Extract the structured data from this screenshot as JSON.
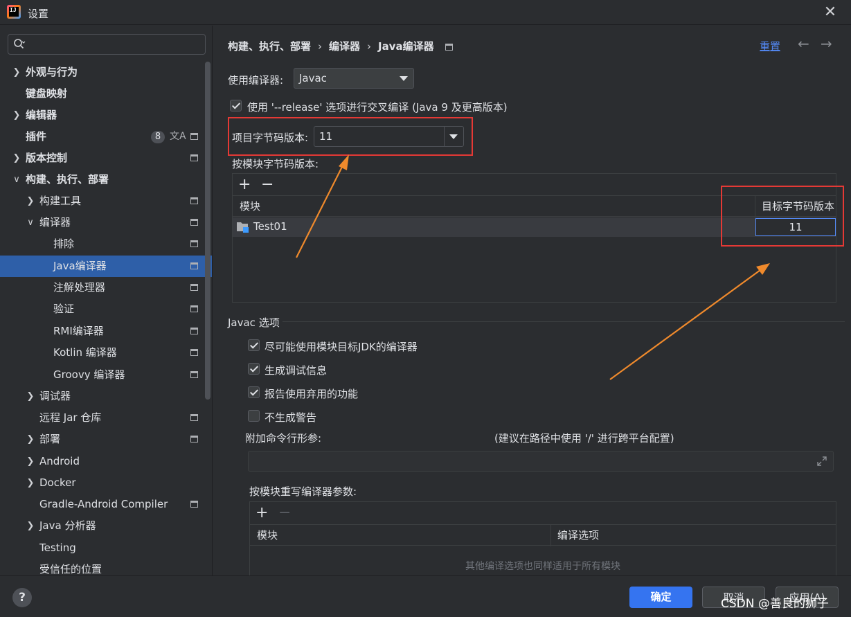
{
  "window": {
    "title": "设置",
    "close_glyph": "✕"
  },
  "sidebar": {
    "search_placeholder": "",
    "items": [
      {
        "label": "外观与行为",
        "expanded": false,
        "has_children": true
      },
      {
        "label": "键盘映射"
      },
      {
        "label": "编辑器",
        "has_children": true
      },
      {
        "label": "插件",
        "badge": "8"
      },
      {
        "label": "版本控制",
        "has_children": true
      },
      {
        "label": "构建、执行、部署",
        "expanded": true,
        "has_children": true
      },
      {
        "label": "构建工具",
        "has_children": true
      },
      {
        "label": "编译器",
        "expanded": true,
        "has_children": true
      },
      {
        "label": "排除"
      },
      {
        "label": "Java编译器",
        "selected": true
      },
      {
        "label": "注解处理器"
      },
      {
        "label": "验证"
      },
      {
        "label": "RMI编译器"
      },
      {
        "label": "Kotlin 编译器"
      },
      {
        "label": "Groovy 编译器"
      },
      {
        "label": "调试器",
        "has_children": true
      },
      {
        "label": "远程 Jar 仓库"
      },
      {
        "label": "部署",
        "has_children": true
      },
      {
        "label": "Android",
        "has_children": true
      },
      {
        "label": "Docker",
        "has_children": true
      },
      {
        "label": "Gradle-Android Compiler"
      },
      {
        "label": "Java 分析器",
        "has_children": true
      },
      {
        "label": "Testing"
      },
      {
        "label": "受信任的位置"
      }
    ]
  },
  "breadcrumb": {
    "part1": "构建、执行、部署",
    "part2": "编译器",
    "part3": "Java编译器",
    "sep": "›"
  },
  "header": {
    "reset": "重置",
    "back": "←",
    "forward": "→"
  },
  "compiler": {
    "use_label": "使用编译器:",
    "use_value": "Javac",
    "release_option_label": "使用 '--release' 选项进行交叉编译 (Java 9 及更高版本)",
    "release_option_checked": true,
    "project_bytecode_label": "项目字节码版本:",
    "project_bytecode_value": "11",
    "per_module_label": "按模块字节码版本:",
    "per_module_table": {
      "add": "+",
      "remove": "−",
      "col_module": "模块",
      "col_target": "目标字节码版本",
      "rows": [
        {
          "module": "Test01",
          "target": "11"
        }
      ]
    }
  },
  "javac": {
    "section_title": "Javac 选项",
    "options": [
      {
        "label": "尽可能使用模块目标JDK的编译器",
        "checked": true
      },
      {
        "label": "生成调试信息",
        "checked": true
      },
      {
        "label": "报告使用弃用的功能",
        "checked": true
      },
      {
        "label": "不生成警告",
        "checked": false
      }
    ],
    "cmd_params_label": "附加命令行形参:",
    "cmd_params_hint": "(建议在路径中使用 '/' 进行跨平台配置)",
    "cmd_params_value": "",
    "override_label": "按模块重写编译器参数:",
    "override_table": {
      "add": "+",
      "remove": "−",
      "col_module": "模块",
      "col_options": "编译选项",
      "empty_text": "其他编译选项也同样适用于所有模块"
    }
  },
  "footer": {
    "help": "?",
    "ok": "确定",
    "cancel": "取消",
    "apply": "应用(A)",
    "watermark": "CSDN @善良的狮子"
  },
  "colors": {
    "accent": "#3574f0",
    "selection": "#2e5fa8",
    "annotation": "#e53935",
    "arrow": "#f08a2c",
    "link": "#548af7"
  }
}
